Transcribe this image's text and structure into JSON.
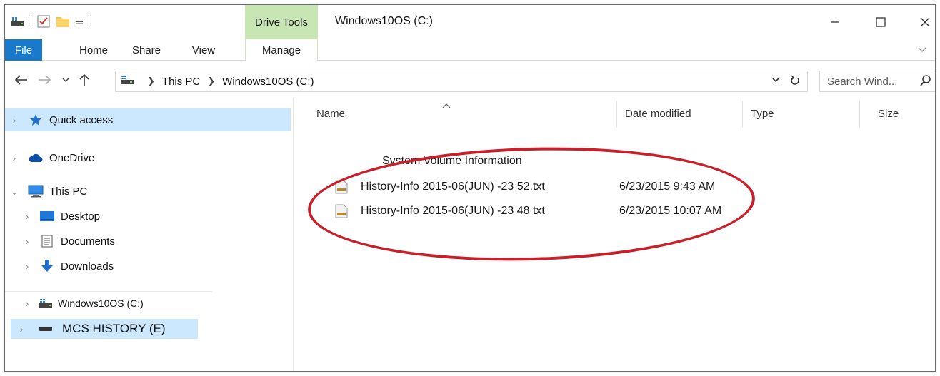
{
  "window": {
    "title": "Windows10OS (C:)",
    "contextual_tab_group": "Drive Tools"
  },
  "ribbon": {
    "tabs": [
      {
        "label": "File"
      },
      {
        "label": "Home"
      },
      {
        "label": "Share"
      },
      {
        "label": "View"
      },
      {
        "label": "Manage"
      }
    ]
  },
  "address_bar": {
    "crumbs": [
      "This PC",
      "Windows10OS (C:)"
    ]
  },
  "search": {
    "placeholder": "Search Wind..."
  },
  "nav_pane": {
    "items": [
      {
        "label": "Quick access",
        "icon": "star-icon",
        "selected": true
      },
      {
        "label": "OneDrive",
        "icon": "cloud-icon"
      },
      {
        "label": "This PC",
        "icon": "computer-icon",
        "expanded": true
      },
      {
        "label": "Desktop",
        "icon": "desktop-folder-icon"
      },
      {
        "label": "Documents",
        "icon": "documents-icon"
      },
      {
        "label": "Downloads",
        "icon": "download-arrow-icon"
      },
      {
        "label": "Windows10OS (C:)",
        "icon": "os-drive-icon"
      },
      {
        "label": "MCS HISTORY (E)",
        "icon": "usb-drive-icon"
      }
    ]
  },
  "file_list": {
    "columns": [
      "Name",
      "Date modified",
      "Type",
      "Size"
    ],
    "rows": [
      {
        "name": "System Volume Information",
        "date": ""
      },
      {
        "name": "History-Info 2015-06(JUN) -23  52.txt",
        "date": "6/23/2015 9:43 AM"
      },
      {
        "name": "History-Info 2015-06(JUN) -23  48 txt",
        "date": "6/23/2015 10:07 AM"
      }
    ]
  },
  "colors": {
    "file_tab_blue": "#1979ca",
    "drive_tools_green": "#c7e6b3",
    "selection_blue": "#cce8ff",
    "annotation_red": "#c8202a"
  }
}
